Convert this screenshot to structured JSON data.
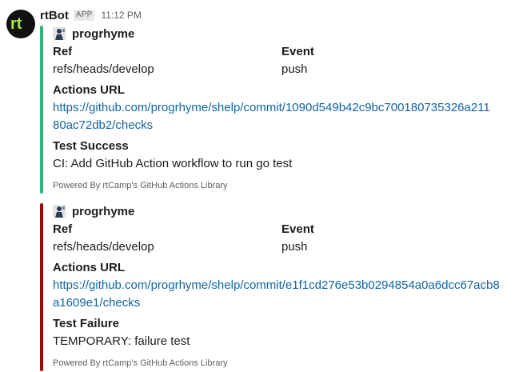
{
  "message": {
    "bot_name": "rtBot",
    "badge": "APP",
    "time": "11:12 PM"
  },
  "colors": {
    "success": "#2eb67d",
    "failure": "#a30200",
    "link": "#1264a3"
  },
  "attachments": [
    {
      "author": "progrhyme",
      "ref_title": "Ref",
      "ref_value": "refs/heads/develop",
      "event_title": "Event",
      "event_value": "push",
      "actions_title": "Actions URL",
      "url_line1": "https://github.com/progrhyme/shelp/commit/1090d549b42c9bc700180735326a211",
      "url_line2": "80ac72db2/checks",
      "result_title": "Test Success",
      "result_value": "CI: Add GitHub Action workflow to run go test",
      "footer": "Powered By rtCamp's GitHub Actions Library"
    },
    {
      "author": "progrhyme",
      "ref_title": "Ref",
      "ref_value": "refs/heads/develop",
      "event_title": "Event",
      "event_value": "push",
      "actions_title": "Actions URL",
      "url_line1": "https://github.com/progrhyme/shelp/commit/e1f1cd276e53b0294854a0a6dcc67acb8",
      "url_line2": "a1609e1/checks",
      "result_title": "Test Failure",
      "result_value": "TEMPORARY: failure test",
      "footer": "Powered By rtCamp's GitHub Actions Library"
    }
  ]
}
